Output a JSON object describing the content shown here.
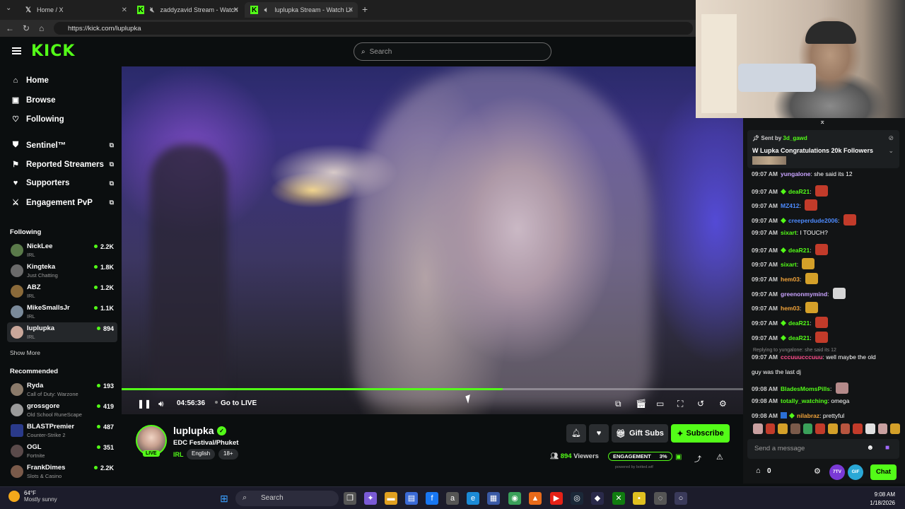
{
  "browser": {
    "tabs": [
      {
        "title": "Home / X",
        "icon": "x-logo-icon",
        "active": false
      },
      {
        "title": "zaddyzavid Stream - Watch Live",
        "icon": "kick-logo-icon",
        "active": false
      },
      {
        "title": "luplupka Stream - Watch Live",
        "icon": "kick-logo-icon",
        "active": true
      }
    ],
    "url": "https://kick.com/luplupka"
  },
  "header": {
    "logo": "KICK",
    "search_placeholder": "Search"
  },
  "sidebar": {
    "nav": [
      {
        "label": "Home",
        "icon": "home-icon"
      },
      {
        "label": "Browse",
        "icon": "browse-icon"
      },
      {
        "label": "Following",
        "icon": "heart-icon"
      }
    ],
    "external": [
      {
        "label": "Sentinel™",
        "icon": "shield-icon"
      },
      {
        "label": "Reported Streamers",
        "icon": "flag-icon"
      },
      {
        "label": "Supporters",
        "icon": "heart-icon"
      },
      {
        "label": "Engagement PvP",
        "icon": "swords-icon"
      }
    ],
    "following_heading": "Following",
    "following": [
      {
        "name": "NickLee",
        "category": "IRL",
        "viewers": "2.2K"
      },
      {
        "name": "Kingteka",
        "category": "Just Chatting",
        "viewers": "1.8K"
      },
      {
        "name": "ABZ",
        "category": "IRL",
        "viewers": "1.2K"
      },
      {
        "name": "MikeSmallsJr",
        "category": "IRL",
        "viewers": "1.1K"
      },
      {
        "name": "luplupka",
        "category": "IRL",
        "viewers": "894"
      }
    ],
    "show_more": "Show More",
    "recommended_heading": "Recommended",
    "recommended": [
      {
        "name": "Ryda",
        "category": "Call of Duty: Warzone",
        "viewers": "193"
      },
      {
        "name": "grossgore",
        "category": "Old School RuneScape",
        "viewers": "419"
      },
      {
        "name": "BLASTPremier",
        "category": "Counter-Strike 2",
        "viewers": "487"
      },
      {
        "name": "OGL",
        "category": "Fortnite",
        "viewers": "351"
      },
      {
        "name": "FrankDimes",
        "category": "Slots & Casino",
        "viewers": "2.2K"
      }
    ]
  },
  "player": {
    "timecode": "04:56:36",
    "go_live": "Go to LIVE",
    "progress": 0.613
  },
  "stream": {
    "streamer": "luplupka",
    "live_badge": "LIVE",
    "title": "EDC Festival/Phuket",
    "category": "IRL",
    "tags": [
      "English",
      "18+"
    ],
    "gift_label": "Gift Subs",
    "subscribe_label": "Subscribe",
    "viewers_count": "894",
    "viewers_label": "Viewers",
    "engagement_label": "ENGAGEMENT",
    "engagement_value": "3%",
    "powered_by": "powered by botted.wtf"
  },
  "chat": {
    "pinned": {
      "sent_by_label": "Sent by",
      "sender": "3d_gawd",
      "message": "W Lupka Congratulations 20k Followers"
    },
    "messages": [
      {
        "time": "09:07 AM",
        "user": "yungalone",
        "color": "#c9a3ff",
        "text": "she said its 12",
        "badge": "none",
        "emote": ""
      },
      {
        "time": "09:07 AM",
        "user": "deaR21",
        "color": "#53fc18",
        "text": "",
        "badge": "green",
        "emote": "r"
      },
      {
        "time": "09:07 AM",
        "user": "MZ412",
        "color": "#4d8bff",
        "text": "",
        "badge": "none",
        "emote": "r"
      },
      {
        "time": "09:07 AM",
        "user": "creeperdude2006",
        "color": "#4d8bff",
        "text": "",
        "badge": "green",
        "emote": "r"
      },
      {
        "time": "09:07 AM",
        "user": "sixart",
        "color": "#53fc18",
        "text": "I TOUCH?",
        "badge": "none",
        "emote": ""
      },
      {
        "time": "09:07 AM",
        "user": "deaR21",
        "color": "#53fc18",
        "text": "",
        "badge": "green",
        "emote": "r"
      },
      {
        "time": "09:07 AM",
        "user": "sixart",
        "color": "#53fc18",
        "text": "",
        "badge": "none",
        "emote": "y"
      },
      {
        "time": "09:07 AM",
        "user": "hem03",
        "color": "#f1a33a",
        "text": "",
        "badge": "none",
        "emote": "y"
      },
      {
        "time": "09:07 AM",
        "user": "greenonmymind",
        "color": "#c9a3ff",
        "text": "",
        "badge": "none",
        "emote": "s"
      },
      {
        "time": "09:07 AM",
        "user": "hem03",
        "color": "#f1a33a",
        "text": "",
        "badge": "none",
        "emote": "y"
      },
      {
        "time": "09:07 AM",
        "user": "deaR21",
        "color": "#53fc18",
        "text": "",
        "badge": "green",
        "emote": "r"
      },
      {
        "time": "09:07 AM",
        "user": "deaR21",
        "color": "#53fc18",
        "text": "",
        "badge": "green",
        "emote": "r"
      }
    ],
    "reply_context": "Replying to yungalone: she said its 12",
    "messages2": [
      {
        "time": "09:07 AM",
        "user": "cccuuucccuuu",
        "color": "#ff4d8b",
        "text": "well maybe the old",
        "badge": "none",
        "emote": ""
      },
      {
        "time": "",
        "user": "",
        "color": "#ffffff",
        "text": "guy was the last dj",
        "badge": "none",
        "emote": ""
      },
      {
        "time": "09:08 AM",
        "user": "BladesMomsPills",
        "color": "#53fc18",
        "text": "",
        "badge": "none",
        "emote": "p"
      },
      {
        "time": "09:08 AM",
        "user": "totally_watching",
        "color": "#53fc18",
        "text": "omega",
        "badge": "none",
        "emote": ""
      },
      {
        "time": "09:08 AM",
        "user": "nilabraz",
        "color": "#f1a33a",
        "text": "prettyful",
        "badge": "blue-green",
        "emote": ""
      }
    ],
    "input_placeholder": "Send a message",
    "points": "0",
    "chat_button": "Chat",
    "round_buttons": [
      "7TV",
      "GIF",
      ""
    ]
  },
  "taskbar": {
    "temp": "64°F",
    "condition": "Mostly sunny",
    "search": "Search",
    "time": "9:08 AM",
    "date": "1/18/2026"
  }
}
